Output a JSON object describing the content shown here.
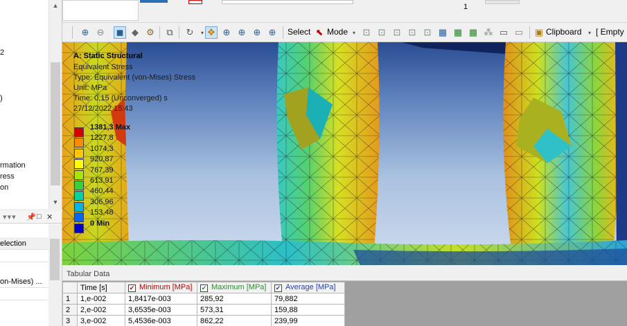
{
  "outline": {
    "items": [
      "2",
      ")",
      "rmation",
      "ress",
      "on"
    ]
  },
  "details": {
    "header_icons": [
      "pin-icon",
      "restore-icon",
      "close-icon"
    ],
    "rows": [
      "election",
      "",
      "on-Mises) ...",
      ""
    ]
  },
  "toolbar_top": {
    "page_number": "1"
  },
  "toolbar": {
    "select_label": "Select",
    "mode_label": "Mode",
    "clipboard_label": "Clipboard",
    "empty_label": "[ Empty"
  },
  "viewport": {
    "info": {
      "title": "A: Static Structural",
      "result": "Equivalent Stress",
      "type": "Type: Equivalent (von-Mises) Stress",
      "unit": "Unit: MPa",
      "time": "Time: 0,15 (Unconverged) s",
      "date": "27/12/2022 15:43"
    },
    "legend": {
      "values": [
        "1381,3 Max",
        "1227,8",
        "1074,3",
        "920,87",
        "767,39",
        "613,91",
        "460,44",
        "306,96",
        "153,48",
        "0 Min"
      ],
      "colors": [
        "#d40000",
        "#ff8c00",
        "#ffc800",
        "#ffff00",
        "#a8e600",
        "#3ccf3c",
        "#00d2a0",
        "#00b4e6",
        "#0064ff",
        "#0000c8"
      ]
    }
  },
  "tabular": {
    "title": "Tabular Data",
    "columns": [
      "Time [s]",
      "Minimum [MPa]",
      "Maximum [MPa]",
      "Average [MPa]"
    ],
    "column_colors": [
      "#000000",
      "#c00000",
      "#2e8b2e",
      "#1f3fbf"
    ],
    "rows": [
      [
        "1",
        "1,e-002",
        "1,8417e-003",
        "285,92",
        "79,882"
      ],
      [
        "2",
        "2,e-002",
        "3,6535e-003",
        "573,31",
        "159,88"
      ],
      [
        "3",
        "3,e-002",
        "5,4536e-003",
        "862,22",
        "239,99"
      ]
    ]
  }
}
